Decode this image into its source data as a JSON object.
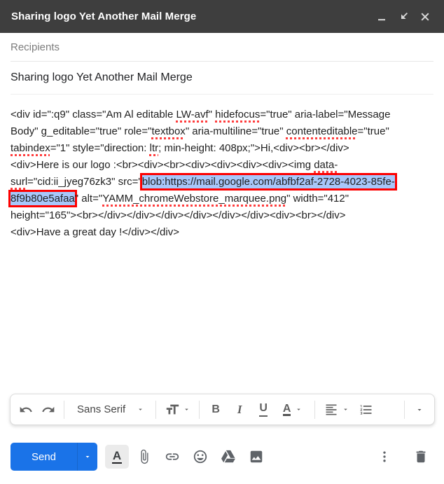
{
  "window": {
    "title": "Sharing logo Yet Another Mail Merge",
    "controls": [
      "minimize",
      "exit-fullscreen",
      "close"
    ]
  },
  "colors": {
    "header_bg": "#3e3e3e",
    "send_blue": "#1a73e8",
    "selection_blue": "#a8c7fa",
    "outline_red": "#fd0000",
    "spellcheck_red": "#ff3d3d"
  },
  "recipients": {
    "placeholder": "Recipients"
  },
  "subject": {
    "value": "Sharing logo Yet Another Mail Merge"
  },
  "body": {
    "lines": [
      [
        {
          "t": "<div id=\":q9\" class=\"Am Al editable "
        },
        {
          "t": "LW-avf",
          "s": true
        },
        {
          "t": "\" "
        },
        {
          "t": "hidefocus",
          "s": true
        },
        {
          "t": "=\"true\" aria-label=\"Message"
        }
      ],
      [
        {
          "t": "Body\" g_editable=\"true\" role=\""
        },
        {
          "t": "textbox",
          "s": true
        },
        {
          "t": "\" aria-multiline=\"true\" "
        },
        {
          "t": "contenteditable",
          "s": true
        },
        {
          "t": "=\"true\""
        }
      ],
      [
        {
          "t": "tabindex",
          "s": true
        },
        {
          "t": "=\"1\" style=\"direction: "
        },
        {
          "t": "ltr",
          "s": true
        },
        {
          "t": "; min-height: 408px;\">Hi,<div><br></div>"
        }
      ],
      [
        {
          "t": "<div>Here is our logo :<br><div><br><div><div><div><div><img "
        },
        {
          "t": "data-",
          "s": true
        }
      ],
      [
        {
          "t": "surl",
          "s": true
        },
        {
          "t": "=\"cid:ii_jyeg76zk3\" src=\""
        },
        {
          "t": "blob:https://mail.google.com/abfbf2af-2728-4023-85fe-",
          "h": true,
          "b": true
        }
      ],
      [
        {
          "t": "8f9b80e5afaa",
          "h": true,
          "b": true
        },
        {
          "t": "\" alt=\""
        },
        {
          "t": "YAMM_chromeWebstore_marquee.png",
          "s": true
        },
        {
          "t": "\" width=\"412\""
        }
      ],
      [
        {
          "t": "height=\"165\"><br></div></div></div></div></div></div><div><br></div>"
        }
      ],
      [
        {
          "t": "<div>Have a great day !</div></div>"
        }
      ]
    ]
  },
  "format_toolbar": {
    "font_family_label": "Sans Serif",
    "bold_label": "B",
    "italic_label": "I",
    "underline_label": "U",
    "text_color_label": "A",
    "icons": [
      "undo-icon",
      "redo-icon",
      "chevron-down-icon",
      "format-size-icon",
      "align-left-icon",
      "numbered-list-icon",
      "more-options-chevron-icon"
    ]
  },
  "action_bar": {
    "send_label": "Send",
    "formatting_label": "A",
    "icons": [
      "chevron-down-icon",
      "paperclip-icon",
      "link-icon",
      "emoji-icon",
      "drive-icon",
      "image-icon",
      "more-vert-icon",
      "trash-icon"
    ]
  }
}
